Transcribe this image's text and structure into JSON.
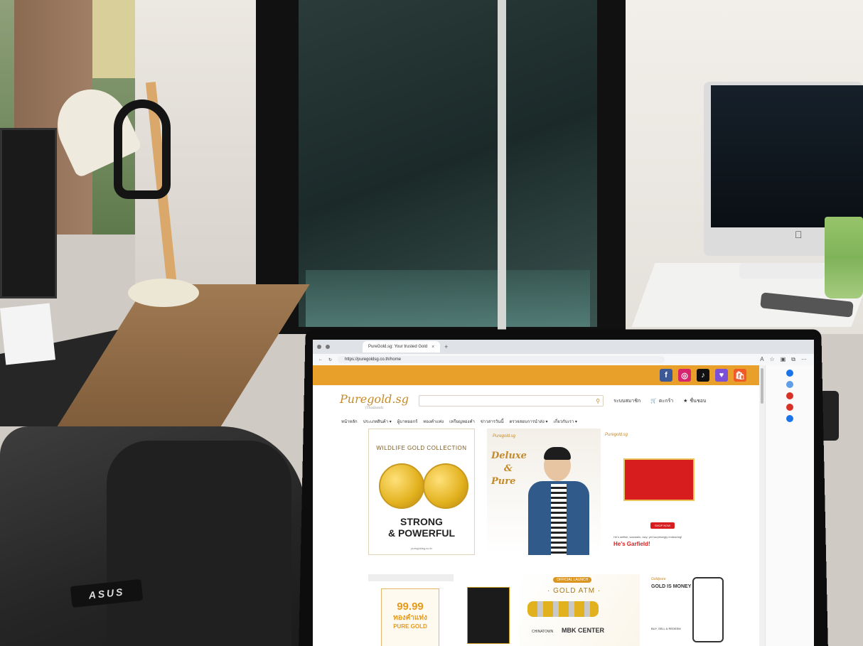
{
  "photo": {
    "laptop_brand": "ASUS"
  },
  "browser": {
    "tab_title": "PureGold.sg: Your trusted Gold",
    "url": "https://puregoldsg.co.th/home"
  },
  "site": {
    "logo": "Puregold.sg",
    "logo_sub": "(Thailand)",
    "header_links": [
      "ระบบสมาชิก",
      "ตะกร้า",
      "ชื่นชอบ"
    ],
    "menu": [
      "หน้าหลัก",
      "ประเภทสินค้า ▾",
      "ผู้บาทออกร้",
      "ทองคำแท่ง",
      "เหรียญทองคำ",
      "ข่าวสารวันนี้",
      "ตรวจสอบการนำส่ง ▾",
      "เกี่ยวกับเรา ▾"
    ],
    "banners": {
      "wildlife_title": "WILDLIFE GOLD COLLECTION",
      "wildlife_slogan_1": "STRONG",
      "wildlife_slogan_2": "& POWERFUL",
      "wildlife_site": "puregoldsg.co.th",
      "deluxe_brand": "Puregold.sg",
      "deluxe_text_1": "Deluxe",
      "deluxe_text_2": "&",
      "deluxe_text_3": "Pure",
      "garfield_brand": "Puregold.sg",
      "garfield_button": "SHOP NOW",
      "garfield_desc": "He's selfish, sarcastic, lazy, yet surprisingly endearing!",
      "garfield_title": "He's Garfield!"
    },
    "cards": {
      "c1_number": "99.99",
      "c1_thai": "ทองคำแท่ง",
      "c1_label": "PURE GOLD",
      "c3_launch": "OFFICIAL LAUNCH",
      "c3_title": "· GOLD ATM ·",
      "c3_loc1": "CHINATOWN",
      "c3_loc2": "MBK CENTER",
      "c4_brand": "Goldpure",
      "c4_title": "GOLD IS MONEY",
      "c4_sub": "BUY, SELL & REDEEM"
    },
    "social": {
      "facebook": "f",
      "instagram": "◎",
      "tiktok": "♪",
      "line": "♥",
      "shop": "🛍"
    }
  }
}
